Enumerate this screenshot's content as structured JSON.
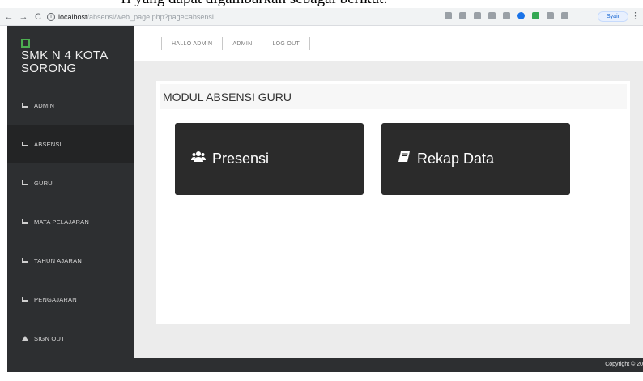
{
  "caption": "ri yang dapat digambarkan sebagai berikut:",
  "browser": {
    "back": "←",
    "forward": "→",
    "reload": "C",
    "url_host": "localhost",
    "url_path": "/absensi/web_page.php?page=absensi",
    "profile_label": "Syair"
  },
  "sidebar": {
    "brand": "SMK N 4 KOTA SORONG",
    "items": [
      {
        "label": "ADMIN"
      },
      {
        "label": "ABSENSI"
      },
      {
        "label": "GURU"
      },
      {
        "label": "MATA PELAJARAN"
      },
      {
        "label": "TAHUN AJARAN"
      },
      {
        "label": "PENGAJARAN"
      },
      {
        "label": "SIGN OUT"
      }
    ]
  },
  "topbar": {
    "greeting": "HALLO ADMIN",
    "user": "ADMIN",
    "logout": "LOG OUT"
  },
  "main": {
    "title": "MODUL ABSENSI GURU",
    "tiles": [
      {
        "label": "Presensi",
        "icon": "users-icon"
      },
      {
        "label": "Rekap Data",
        "icon": "book-icon"
      }
    ]
  },
  "footer": {
    "copyright": "Copyright © 20"
  },
  "colors": {
    "sidebar_bg": "#2d2f31",
    "tile_bg": "#2b2b2b",
    "content_bg": "#ececec",
    "brand_accent": "#4caf50"
  }
}
